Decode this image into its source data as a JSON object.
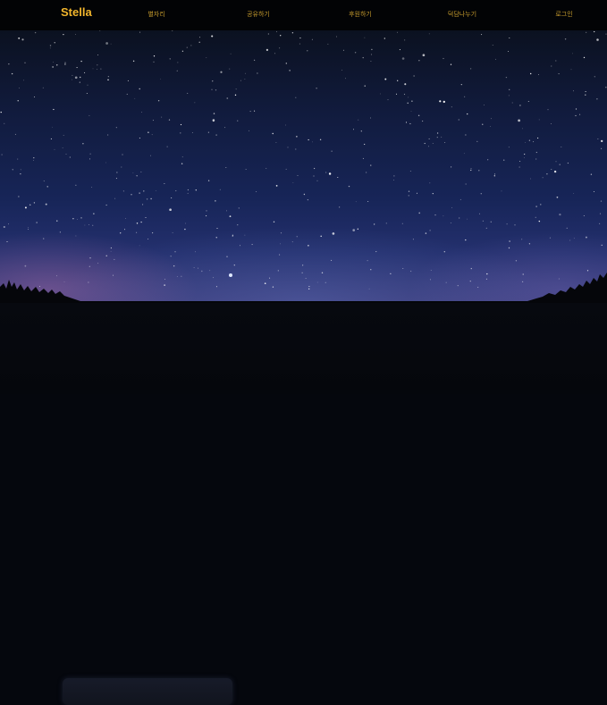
{
  "nav": {
    "brand": "Stella",
    "items": [
      {
        "label": "별자리"
      },
      {
        "label": "공유하기"
      },
      {
        "label": "후원하기"
      },
      {
        "label": "덕담나누기"
      },
      {
        "label": "로그인"
      }
    ]
  },
  "colors": {
    "brand": "#f1b52c",
    "nav_text": "#c49a2d",
    "nav_bg": "#020305",
    "sky_top": "#0b1120",
    "sky_bottom": "#3a3b7a"
  }
}
